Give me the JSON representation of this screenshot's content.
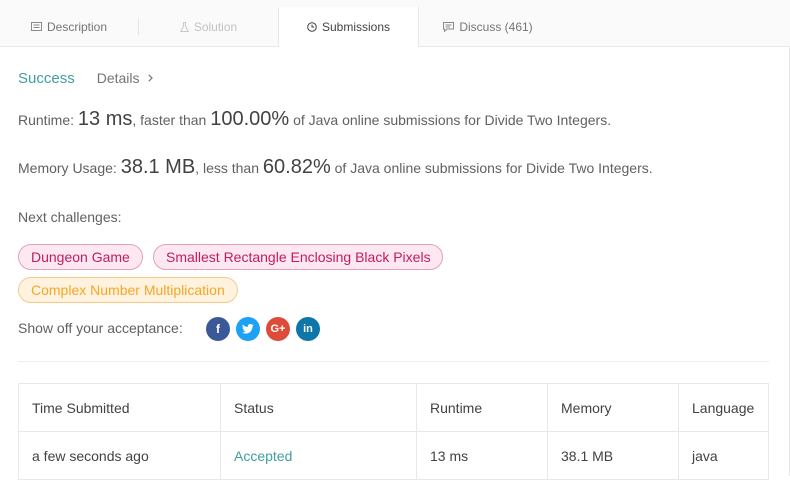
{
  "tabs": {
    "description": "Description",
    "solution": "Solution",
    "submissions": "Submissions",
    "discuss": "Discuss (461)"
  },
  "result": {
    "status": "Success",
    "details_link": "Details"
  },
  "runtime": {
    "label": "Runtime: ",
    "value": "13 ms",
    "compare": ", faster than ",
    "percent": "100.00%",
    "suffix": " of Java online submissions for Divide Two Integers."
  },
  "memory": {
    "label": "Memory Usage: ",
    "value": "38.1 MB",
    "compare": ", less than ",
    "percent": "60.82%",
    "suffix": " of Java online submissions for Divide Two Integers."
  },
  "next_challenges": {
    "label": "Next challenges:",
    "items": [
      {
        "label": "Dungeon Game",
        "difficulty_color": "#c41a63"
      },
      {
        "label": "Smallest Rectangle Enclosing Black Pixels",
        "difficulty_color": "#c41a63"
      },
      {
        "label": "Complex Number Multiplication",
        "difficulty_color": "#f5a623"
      }
    ]
  },
  "share": {
    "label": "Show off your acceptance:",
    "icons": [
      "facebook-icon",
      "twitter-icon",
      "google-plus-icon",
      "linkedin-icon"
    ]
  },
  "table": {
    "headers": [
      "Time Submitted",
      "Status",
      "Runtime",
      "Memory",
      "Language"
    ],
    "rows": [
      [
        "a few seconds ago",
        "Accepted",
        "13 ms",
        "38.1 MB",
        "java"
      ]
    ]
  },
  "colors": {
    "accent": "#409f9f",
    "hard": "#c41a63",
    "medium": "#f5a623"
  }
}
